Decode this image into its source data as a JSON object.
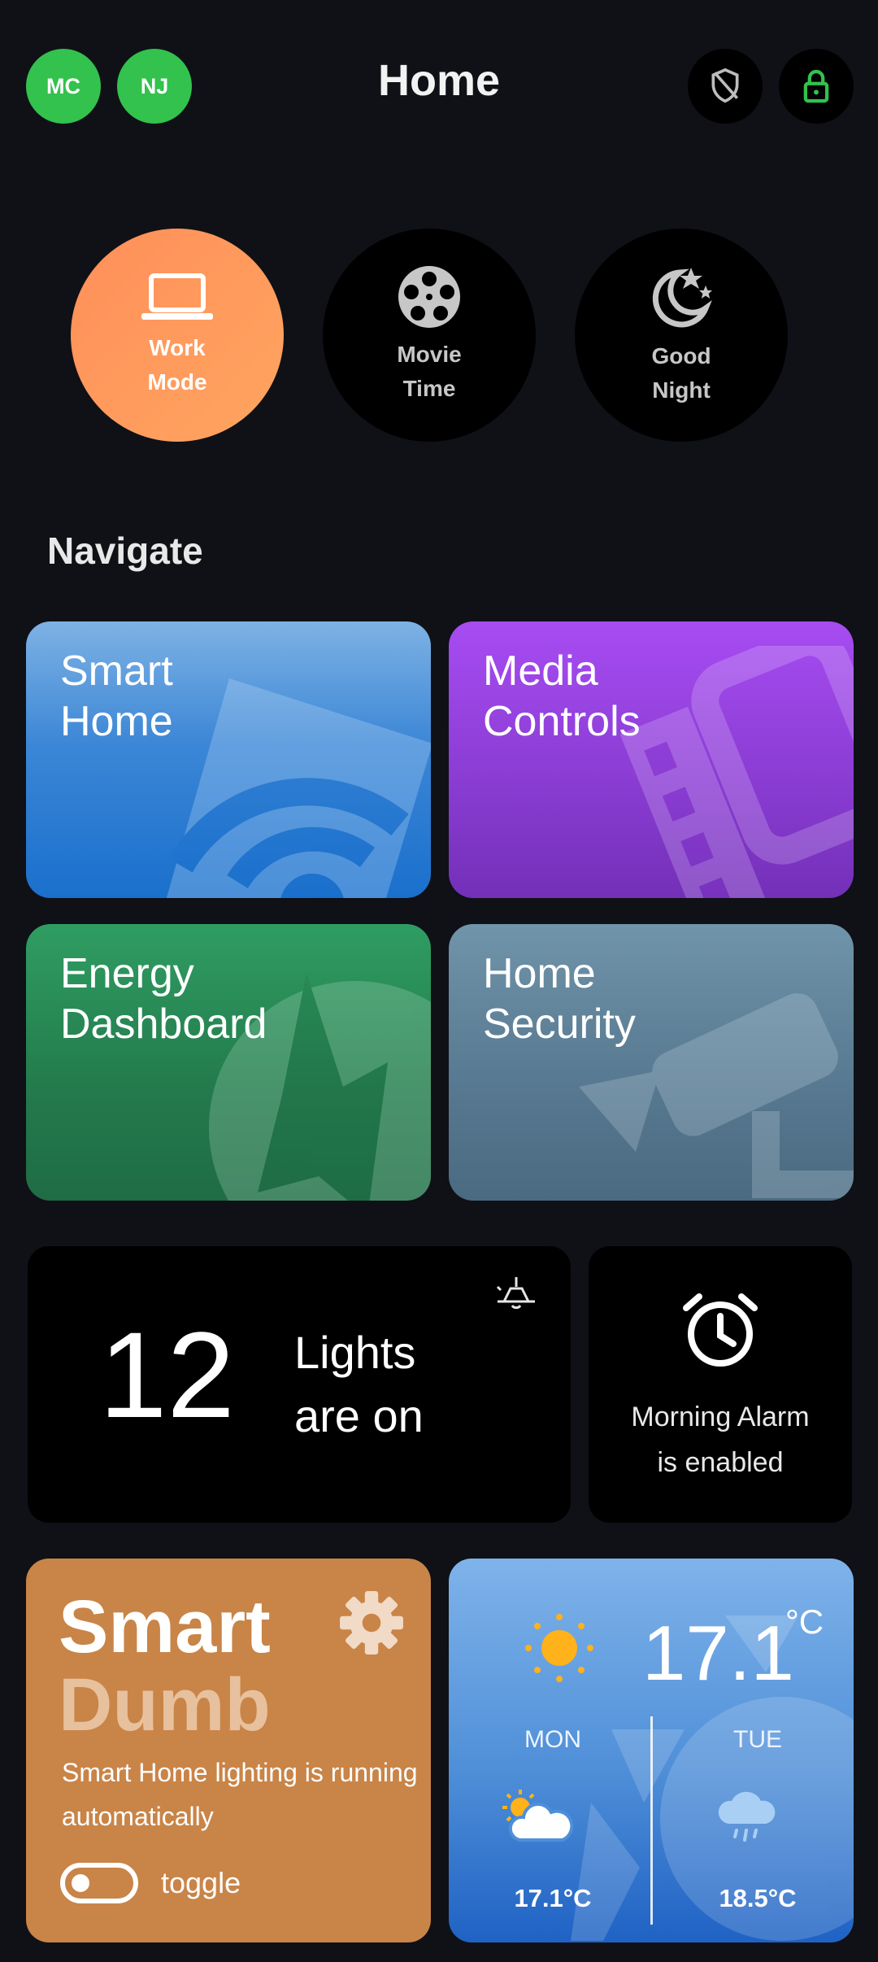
{
  "header": {
    "title": "Home",
    "avatars": [
      "MC",
      "NJ"
    ],
    "icons": [
      "shield-off-icon",
      "lock-icon"
    ],
    "accent": "#32c24d"
  },
  "scenes": [
    {
      "line1": "Work",
      "line2": "Mode",
      "icon": "laptop-icon",
      "active": true
    },
    {
      "line1": "Movie",
      "line2": "Time",
      "icon": "film-reel-icon",
      "active": false
    },
    {
      "line1": "Good",
      "line2": "Night",
      "icon": "moon-stars-icon",
      "active": false
    }
  ],
  "navigate": {
    "heading": "Navigate",
    "cards": [
      {
        "line1": "Smart",
        "line2": "Home",
        "color": "#2f7fd2"
      },
      {
        "line1": "Media",
        "line2": "Controls",
        "color": "#9a45e0"
      },
      {
        "line1": "Energy",
        "line2": "Dashboard",
        "color": "#27905a"
      },
      {
        "line1": "Home",
        "line2": "Security",
        "color": "#6788a0"
      }
    ]
  },
  "lights": {
    "count": "12",
    "line1": "Lights",
    "line2": "are on"
  },
  "alarm": {
    "line1": "Morning Alarm",
    "line2": "is enabled"
  },
  "smart_dumb": {
    "word1": "Smart",
    "word2": "Dumb",
    "description": "Smart Home lighting is running automatically",
    "toggle_label": "toggle"
  },
  "weather": {
    "current_temp": "17.1",
    "unit": "°C",
    "days": [
      {
        "name": "MON",
        "temp": "17.1°C",
        "icon": "partly-sunny-icon"
      },
      {
        "name": "TUE",
        "temp": "18.5°C",
        "icon": "rain-cloud-icon"
      }
    ]
  }
}
